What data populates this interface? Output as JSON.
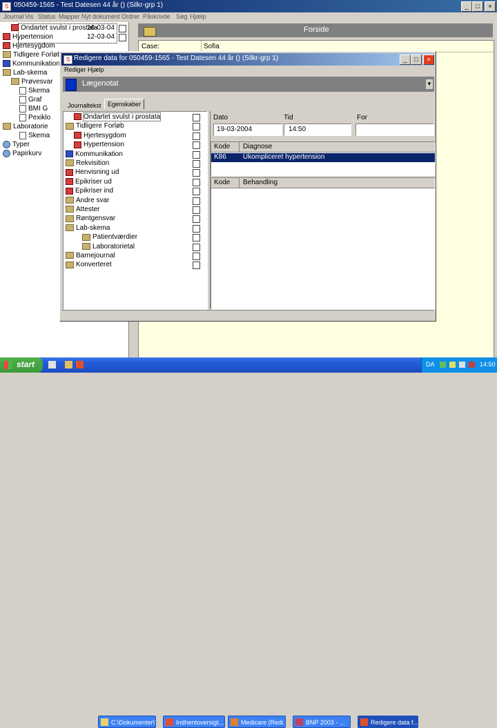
{
  "main_window": {
    "title": "050459-1565 - Test Datesen 44 år () (Silkr-grp 1)",
    "menu": [
      "Journal",
      "Vis",
      "Status",
      "Mapper",
      "Nyt dokument",
      "Ordrer",
      "Påskrivde",
      "Søg",
      "Hjælp"
    ],
    "left_tree": [
      {
        "label": "Ondartet svulst i prostata",
        "date": "16-03-04",
        "indent": 1,
        "icon": "red"
      },
      {
        "label": "Hypertension",
        "date": "12-03-04",
        "indent": 0,
        "icon": "red"
      },
      {
        "label": "Hjertesygdom",
        "date": "",
        "indent": 0,
        "icon": "red"
      },
      {
        "label": "Tidligere Forløb",
        "date": "",
        "indent": 0,
        "icon": "folder"
      },
      {
        "label": "Kommunikation",
        "date": "",
        "indent": 0,
        "icon": "blue"
      },
      {
        "label": "Lab-skema",
        "date": "",
        "indent": 0,
        "icon": "folder"
      },
      {
        "label": "Prøvesvar",
        "date": "",
        "indent": 1,
        "icon": "folder"
      },
      {
        "label": "Skema",
        "date": "",
        "indent": 2,
        "icon": "doc"
      },
      {
        "label": "Graf",
        "date": "",
        "indent": 2,
        "icon": "doc"
      },
      {
        "label": "BMI G",
        "date": "",
        "indent": 2,
        "icon": "doc"
      },
      {
        "label": "Pexiklo",
        "date": "",
        "indent": 2,
        "icon": "doc"
      },
      {
        "label": "Laboratorie",
        "date": "",
        "indent": 0,
        "icon": "folder"
      },
      {
        "label": "Skema",
        "date": "",
        "indent": 2,
        "icon": "doc"
      },
      {
        "label": "Typer",
        "date": "",
        "indent": 0,
        "icon": "glob"
      },
      {
        "label": "Papirkurv",
        "date": "",
        "indent": 0,
        "icon": "glob"
      }
    ],
    "right_panel_title": "Forside",
    "case_label": "Case:",
    "case_value": "Sofia"
  },
  "dialog": {
    "title": "Redigere data for 050459-1565 - Test Datesen 44 år () (Silkr-grp 1)",
    "menu": [
      "Rediger",
      "Hjælp"
    ],
    "doc_type": "Lægenotat",
    "tabs": [
      "Journaltekst",
      "Egenskaber"
    ],
    "tree": [
      {
        "label": "Ondartet svulst i prostata",
        "indent": 1,
        "icon": "red"
      },
      {
        "label": "Tidligere Forløb",
        "indent": 0,
        "icon": "folder"
      },
      {
        "label": "Hjertesygdom",
        "indent": 1,
        "icon": "red"
      },
      {
        "label": "Hypertension",
        "indent": 1,
        "icon": "red"
      },
      {
        "label": "Kommunikation",
        "indent": 0,
        "icon": "blue"
      },
      {
        "label": "Rekvisition",
        "indent": 0,
        "icon": "folder"
      },
      {
        "label": "Henvisning ud",
        "indent": 0,
        "icon": "red"
      },
      {
        "label": "Epikriser ud",
        "indent": 0,
        "icon": "red"
      },
      {
        "label": "Epikriser ind",
        "indent": 0,
        "icon": "red"
      },
      {
        "label": "Andre svar",
        "indent": 0,
        "icon": "folder"
      },
      {
        "label": "Attester",
        "indent": 0,
        "icon": "folder"
      },
      {
        "label": "Røntgensvar",
        "indent": 0,
        "icon": "folder"
      },
      {
        "label": "Lab-skema",
        "indent": 0,
        "icon": "folder"
      },
      {
        "label": "Patientværdier",
        "indent": 2,
        "icon": "folder"
      },
      {
        "label": "Laboratorietal",
        "indent": 2,
        "icon": "folder"
      },
      {
        "label": "Barnejournal",
        "indent": 0,
        "icon": "folder"
      },
      {
        "label": "Konverteret",
        "indent": 0,
        "icon": "folder"
      }
    ],
    "dato_label": "Dato",
    "dato_value": "19-03-2004",
    "tid_label": "Tid",
    "tid_value": "14:50",
    "for_label": "For",
    "for_value": "",
    "diag_headers": [
      "Kode",
      "Diagnose"
    ],
    "diag_rows": [
      {
        "code": "K86",
        "text": "Ukompliceret hypertension"
      }
    ],
    "beh_headers": [
      "Kode",
      "Behandling"
    ]
  },
  "taskbar": {
    "start_label": "start",
    "tasks": [
      "C:\\Dokumenter\\Vos...",
      "Indhentoversigt...",
      "Medicare (Redi...",
      "BNP 2003 - ...",
      "Redigere data f..."
    ],
    "lang": "DA",
    "clock": "14:50"
  },
  "colors": {
    "title_blue": "#0a246a",
    "panel_yellow": "#ffffe1",
    "taskbar_blue": "#245edb",
    "start_green": "#3c9a3a"
  }
}
